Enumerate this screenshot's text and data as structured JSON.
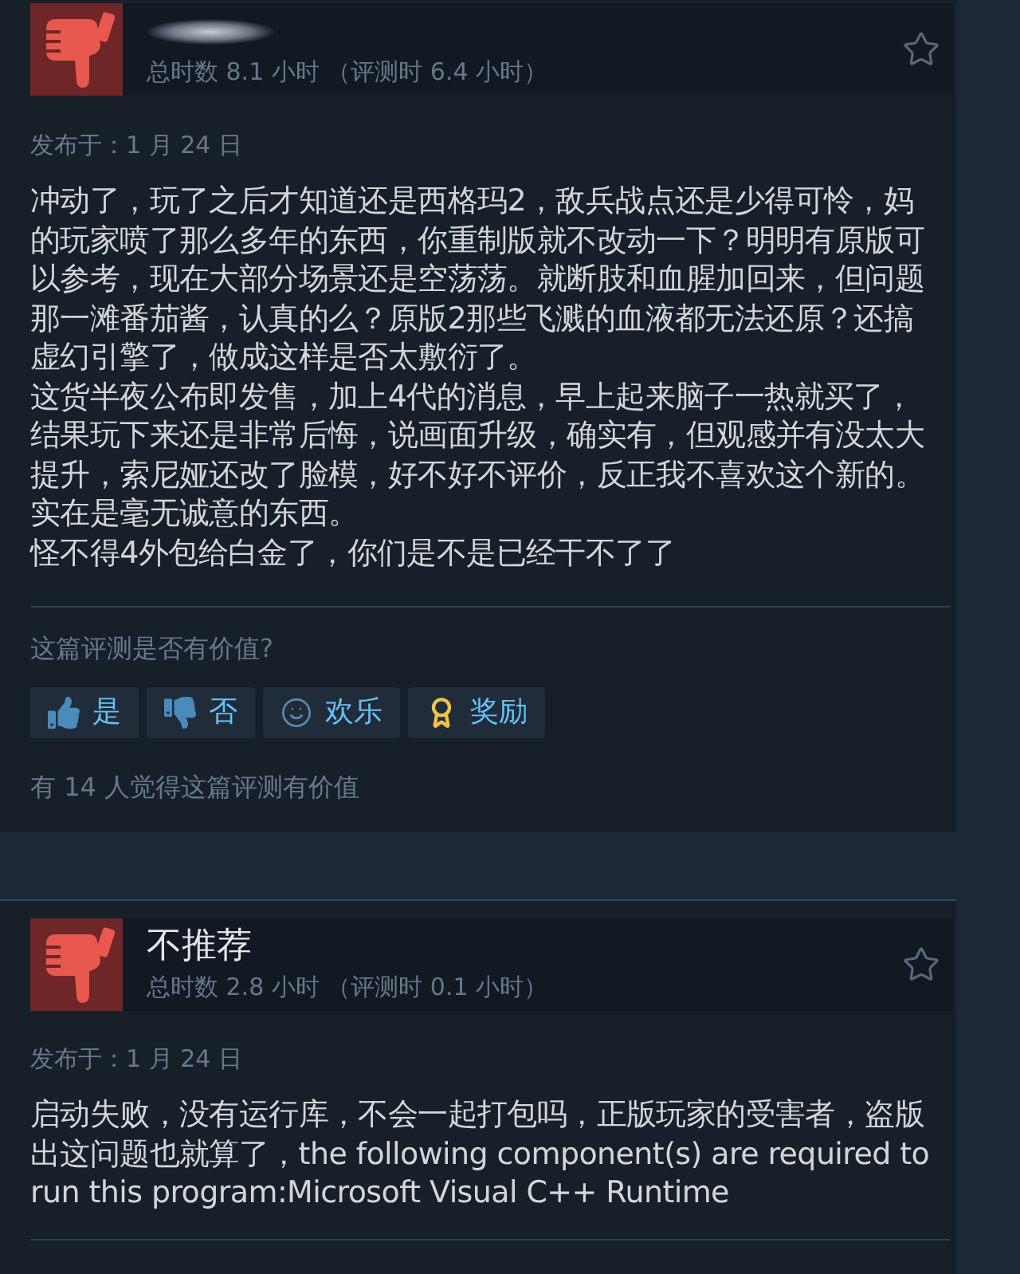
{
  "reviews": [
    {
      "recommended": false,
      "redacted": true,
      "playtime": "总时数 8.1 小时 （评测时 6.4 小时）",
      "posted": "发布于：1 月 24 日",
      "paragraphs": [
        "冲动了，玩了之后才知道还是西格玛2，敌兵战点还是少得可怜，妈的玩家喷了那么多年的东西，你重制版就不改动一下？明明有原版可以参考，现在大部分场景还是空荡荡。就断肢和血腥加回来，但问题那一滩番茄酱，认真的么？原版2那些飞溅的血液都无法还原？还搞虚幻引擎了，做成这样是否太敷衍了。",
        "这货半夜公布即发售，加上4代的消息，早上起来脑子一热就买了，结果玩下来还是非常后悔，说画面升级，确实有，但观感并有没太大提升，索尼娅还改了脸模，好不好不评价，反正我不喜欢这个新的。",
        "实在是毫无诚意的东西。",
        "怪不得4外包给白金了，你们是不是已经干不了了"
      ],
      "question": "这篇评测是否有价值?",
      "buttons": [
        {
          "kind": "yes",
          "label": "是"
        },
        {
          "kind": "no",
          "label": "否"
        },
        {
          "kind": "funny",
          "label": "欢乐"
        },
        {
          "kind": "award",
          "label": "奖励"
        }
      ],
      "helpful": "有 14 人觉得这篇评测有价值"
    },
    {
      "recommended": false,
      "redacted": false,
      "title": "不推荐",
      "playtime": "总时数 2.8 小时 （评测时 0.1 小时）",
      "posted": "发布于：1 月 24 日",
      "paragraphs": [
        "启动失败，没有运行库，不会一起打包吗，正版玩家的受害者，盗版出这问题也就算了，the following component(s) are required to run this program:Microsoft Visual C++ Runtime"
      ]
    }
  ]
}
